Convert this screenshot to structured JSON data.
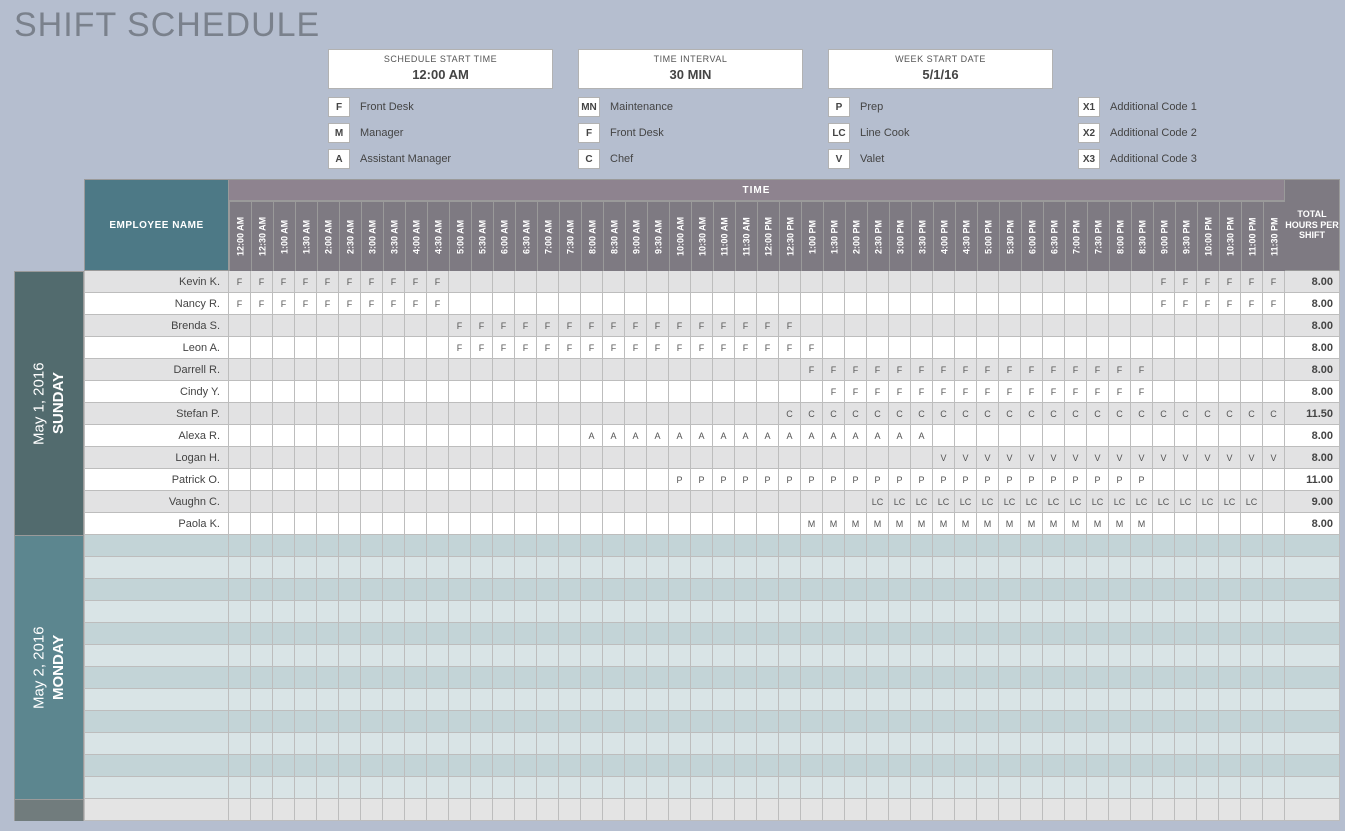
{
  "title": "SHIFT SCHEDULE",
  "fields": {
    "startTime": {
      "label": "SCHEDULE START TIME",
      "value": "12:00 AM"
    },
    "interval": {
      "label": "TIME INTERVAL",
      "value": "30 MIN"
    },
    "weekStart": {
      "label": "WEEK START DATE",
      "value": "5/1/16"
    }
  },
  "legend": [
    [
      {
        "code": "F",
        "label": "Front Desk"
      },
      {
        "code": "M",
        "label": "Manager"
      },
      {
        "code": "A",
        "label": "Assistant Manager"
      }
    ],
    [
      {
        "code": "MN",
        "label": "Maintenance"
      },
      {
        "code": "F",
        "label": "Front Desk"
      },
      {
        "code": "C",
        "label": "Chef"
      }
    ],
    [
      {
        "code": "P",
        "label": "Prep"
      },
      {
        "code": "LC",
        "label": "Line Cook"
      },
      {
        "code": "V",
        "label": "Valet"
      }
    ],
    [
      {
        "code": "X1",
        "label": "Additional Code 1"
      },
      {
        "code": "X2",
        "label": "Additional Code 2"
      },
      {
        "code": "X3",
        "label": "Additional Code 3"
      }
    ]
  ],
  "headers": {
    "employee": "EMPLOYEE NAME",
    "timeTitle": "TIME",
    "total": "TOTAL HOURS PER SHIFT"
  },
  "timeSlots": [
    "12:00 AM",
    "12:30 AM",
    "1:00 AM",
    "1:30 AM",
    "2:00 AM",
    "2:30 AM",
    "3:00 AM",
    "3:30 AM",
    "4:00 AM",
    "4:30 AM",
    "5:00 AM",
    "5:30 AM",
    "6:00 AM",
    "6:30 AM",
    "7:00 AM",
    "7:30 AM",
    "8:00 AM",
    "8:30 AM",
    "9:00 AM",
    "9:30 AM",
    "10:00 AM",
    "10:30 AM",
    "11:00 AM",
    "11:30 AM",
    "12:00 PM",
    "12:30 PM",
    "1:00 PM",
    "1:30 PM",
    "2:00 PM",
    "2:30 PM",
    "3:00 PM",
    "3:30 PM",
    "4:00 PM",
    "4:30 PM",
    "5:00 PM",
    "5:30 PM",
    "6:00 PM",
    "6:30 PM",
    "7:00 PM",
    "7:30 PM",
    "8:00 PM",
    "8:30 PM",
    "9:00 PM",
    "9:30 PM",
    "10:00 PM",
    "10:30 PM",
    "11:00 PM",
    "11:30 PM"
  ],
  "days": [
    {
      "id": "sun",
      "name": "SUNDAY",
      "date": "May 1, 2016",
      "rows": [
        {
          "name": "Kevin K.",
          "total": "8.00",
          "slots": {
            "0": "F",
            "1": "F",
            "2": "F",
            "3": "F",
            "4": "F",
            "5": "F",
            "6": "F",
            "7": "F",
            "8": "F",
            "9": "F",
            "42": "F",
            "43": "F",
            "44": "F",
            "45": "F",
            "46": "F",
            "47": "F"
          }
        },
        {
          "name": "Nancy R.",
          "total": "8.00",
          "slots": {
            "0": "F",
            "1": "F",
            "2": "F",
            "3": "F",
            "4": "F",
            "5": "F",
            "6": "F",
            "7": "F",
            "8": "F",
            "9": "F",
            "42": "F",
            "43": "F",
            "44": "F",
            "45": "F",
            "46": "F",
            "47": "F"
          }
        },
        {
          "name": "Brenda S.",
          "total": "8.00",
          "slots": {
            "10": "F",
            "11": "F",
            "12": "F",
            "13": "F",
            "14": "F",
            "15": "F",
            "16": "F",
            "17": "F",
            "18": "F",
            "19": "F",
            "20": "F",
            "21": "F",
            "22": "F",
            "23": "F",
            "24": "F",
            "25": "F"
          }
        },
        {
          "name": "Leon A.",
          "total": "8.00",
          "slots": {
            "10": "F",
            "11": "F",
            "12": "F",
            "13": "F",
            "14": "F",
            "15": "F",
            "16": "F",
            "17": "F",
            "18": "F",
            "19": "F",
            "20": "F",
            "21": "F",
            "22": "F",
            "23": "F",
            "24": "F",
            "25": "F",
            "26": "F"
          }
        },
        {
          "name": "Darrell R.",
          "total": "8.00",
          "slots": {
            "26": "F",
            "27": "F",
            "28": "F",
            "29": "F",
            "30": "F",
            "31": "F",
            "32": "F",
            "33": "F",
            "34": "F",
            "35": "F",
            "36": "F",
            "37": "F",
            "38": "F",
            "39": "F",
            "40": "F",
            "41": "F"
          }
        },
        {
          "name": "Cindy Y.",
          "total": "8.00",
          "slots": {
            "27": "F",
            "28": "F",
            "29": "F",
            "30": "F",
            "31": "F",
            "32": "F",
            "33": "F",
            "34": "F",
            "35": "F",
            "36": "F",
            "37": "F",
            "38": "F",
            "39": "F",
            "40": "F",
            "41": "F"
          }
        },
        {
          "name": "Stefan P.",
          "total": "11.50",
          "slots": {
            "25": "C",
            "26": "C",
            "27": "C",
            "28": "C",
            "29": "C",
            "30": "C",
            "31": "C",
            "32": "C",
            "33": "C",
            "34": "C",
            "35": "C",
            "36": "C",
            "37": "C",
            "38": "C",
            "39": "C",
            "40": "C",
            "41": "C",
            "42": "C",
            "43": "C",
            "44": "C",
            "45": "C",
            "46": "C",
            "47": "C"
          }
        },
        {
          "name": "Alexa R.",
          "total": "8.00",
          "slots": {
            "16": "A",
            "17": "A",
            "18": "A",
            "19": "A",
            "20": "A",
            "21": "A",
            "22": "A",
            "23": "A",
            "24": "A",
            "25": "A",
            "26": "A",
            "27": "A",
            "28": "A",
            "29": "A",
            "30": "A",
            "31": "A"
          }
        },
        {
          "name": "Logan H.",
          "total": "8.00",
          "slots": {
            "32": "V",
            "33": "V",
            "34": "V",
            "35": "V",
            "36": "V",
            "37": "V",
            "38": "V",
            "39": "V",
            "40": "V",
            "41": "V",
            "42": "V",
            "43": "V",
            "44": "V",
            "45": "V",
            "46": "V",
            "47": "V"
          }
        },
        {
          "name": "Patrick O.",
          "total": "11.00",
          "slots": {
            "20": "P",
            "21": "P",
            "22": "P",
            "23": "P",
            "24": "P",
            "25": "P",
            "26": "P",
            "27": "P",
            "28": "P",
            "29": "P",
            "30": "P",
            "31": "P",
            "32": "P",
            "33": "P",
            "34": "P",
            "35": "P",
            "36": "P",
            "37": "P",
            "38": "P",
            "39": "P",
            "40": "P",
            "41": "P"
          }
        },
        {
          "name": "Vaughn C.",
          "total": "9.00",
          "slots": {
            "29": "LC",
            "30": "LC",
            "31": "LC",
            "32": "LC",
            "33": "LC",
            "34": "LC",
            "35": "LC",
            "36": "LC",
            "37": "LC",
            "38": "LC",
            "39": "LC",
            "40": "LC",
            "41": "LC",
            "42": "LC",
            "43": "LC",
            "44": "LC",
            "45": "LC",
            "46": "LC"
          }
        },
        {
          "name": "Paola K.",
          "total": "8.00",
          "slots": {
            "26": "M",
            "27": "M",
            "28": "M",
            "29": "M",
            "30": "M",
            "31": "M",
            "32": "M",
            "33": "M",
            "34": "M",
            "35": "M",
            "36": "M",
            "37": "M",
            "38": "M",
            "39": "M",
            "40": "M",
            "41": "M"
          }
        }
      ]
    },
    {
      "id": "mon",
      "name": "MONDAY",
      "date": "May 2, 2016",
      "rows": [
        {
          "name": "",
          "total": "",
          "slots": {}
        },
        {
          "name": "",
          "total": "",
          "slots": {}
        },
        {
          "name": "",
          "total": "",
          "slots": {}
        },
        {
          "name": "",
          "total": "",
          "slots": {}
        },
        {
          "name": "",
          "total": "",
          "slots": {}
        },
        {
          "name": "",
          "total": "",
          "slots": {}
        },
        {
          "name": "",
          "total": "",
          "slots": {}
        },
        {
          "name": "",
          "total": "",
          "slots": {}
        },
        {
          "name": "",
          "total": "",
          "slots": {}
        },
        {
          "name": "",
          "total": "",
          "slots": {}
        },
        {
          "name": "",
          "total": "",
          "slots": {}
        },
        {
          "name": "",
          "total": "",
          "slots": {}
        }
      ]
    },
    {
      "id": "tue",
      "name": "",
      "date": "",
      "rows": [
        {
          "name": "",
          "total": "",
          "slots": {}
        }
      ]
    }
  ]
}
